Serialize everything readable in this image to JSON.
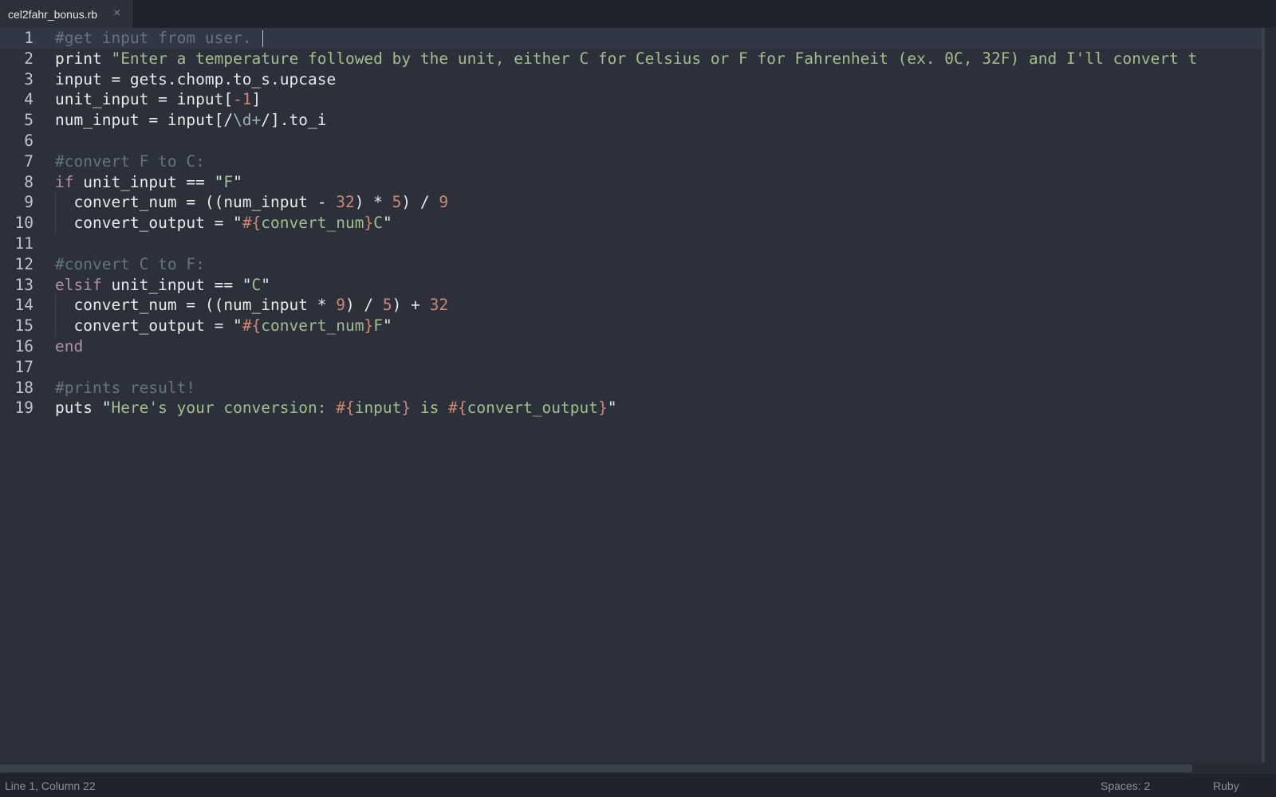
{
  "tab": {
    "title": "cel2fahr_bonus.rb",
    "close_glyph": "×"
  },
  "editor": {
    "current_line": 1,
    "lines": [
      {
        "n": "1",
        "tokens": [
          [
            "comment",
            "#get input from user."
          ]
        ]
      },
      {
        "n": "2",
        "tokens": [
          [
            "plain",
            "print "
          ],
          [
            "string",
            "\"Enter a temperature followed by the unit, either C for Celsius or F for Fahrenheit (ex. 0C, 32F) and I'll convert t"
          ]
        ]
      },
      {
        "n": "3",
        "tokens": [
          [
            "plain",
            "input = gets.chomp.to_s.upcase"
          ]
        ]
      },
      {
        "n": "4",
        "tokens": [
          [
            "plain",
            "unit_input = input["
          ],
          [
            "number",
            "-1"
          ],
          [
            "plain",
            "]"
          ]
        ]
      },
      {
        "n": "5",
        "tokens": [
          [
            "plain",
            "num_input = input[/"
          ],
          [
            "regex",
            "\\d+"
          ],
          [
            "plain",
            "/].to_i"
          ]
        ]
      },
      {
        "n": "6",
        "tokens": []
      },
      {
        "n": "7",
        "tokens": [
          [
            "comment",
            "#convert F to C:"
          ]
        ]
      },
      {
        "n": "8",
        "tokens": [
          [
            "keyword",
            "if"
          ],
          [
            "plain",
            " unit_input == \""
          ],
          [
            "string",
            "F"
          ],
          [
            "plain",
            "\""
          ]
        ]
      },
      {
        "n": "9",
        "tokens": [
          [
            "plain",
            "  convert_num = ((num_input - "
          ],
          [
            "number",
            "32"
          ],
          [
            "plain",
            ") * "
          ],
          [
            "number",
            "5"
          ],
          [
            "plain",
            ") / "
          ],
          [
            "number",
            "9"
          ]
        ]
      },
      {
        "n": "10",
        "tokens": [
          [
            "plain",
            "  convert_output = \""
          ],
          [
            "interp",
            "#{"
          ],
          [
            "string",
            "convert_num"
          ],
          [
            "interp",
            "}"
          ],
          [
            "string",
            "C"
          ],
          [
            "plain",
            "\""
          ]
        ]
      },
      {
        "n": "11",
        "tokens": []
      },
      {
        "n": "12",
        "tokens": [
          [
            "comment",
            "#convert C to F:"
          ]
        ]
      },
      {
        "n": "13",
        "tokens": [
          [
            "keyword",
            "elsif"
          ],
          [
            "plain",
            " unit_input == \""
          ],
          [
            "string",
            "C"
          ],
          [
            "plain",
            "\""
          ]
        ]
      },
      {
        "n": "14",
        "tokens": [
          [
            "plain",
            "  convert_num = ((num_input * "
          ],
          [
            "number",
            "9"
          ],
          [
            "plain",
            ") / "
          ],
          [
            "number",
            "5"
          ],
          [
            "plain",
            ") + "
          ],
          [
            "number",
            "32"
          ]
        ]
      },
      {
        "n": "15",
        "tokens": [
          [
            "plain",
            "  convert_output = \""
          ],
          [
            "interp",
            "#{"
          ],
          [
            "string",
            "convert_num"
          ],
          [
            "interp",
            "}"
          ],
          [
            "string",
            "F"
          ],
          [
            "plain",
            "\""
          ]
        ]
      },
      {
        "n": "16",
        "tokens": [
          [
            "keyword",
            "end"
          ]
        ]
      },
      {
        "n": "17",
        "tokens": []
      },
      {
        "n": "18",
        "tokens": [
          [
            "comment",
            "#prints result!"
          ]
        ]
      },
      {
        "n": "19",
        "tokens": [
          [
            "plain",
            "puts \""
          ],
          [
            "string",
            "Here's your conversion: "
          ],
          [
            "interp",
            "#{"
          ],
          [
            "string",
            "input"
          ],
          [
            "interp",
            "}"
          ],
          [
            "string",
            " is "
          ],
          [
            "interp",
            "#{"
          ],
          [
            "string",
            "convert_output"
          ],
          [
            "interp",
            "}"
          ],
          [
            "plain",
            "\""
          ]
        ]
      }
    ]
  },
  "status": {
    "position": "Line 1, Column 22",
    "indentation": "Spaces: 2",
    "syntax": "Ruby"
  },
  "colors": {
    "background": "#2b303b",
    "comment": "#65737e",
    "string": "#a3be8c",
    "number": "#d08770",
    "keyword": "#b48ead"
  }
}
